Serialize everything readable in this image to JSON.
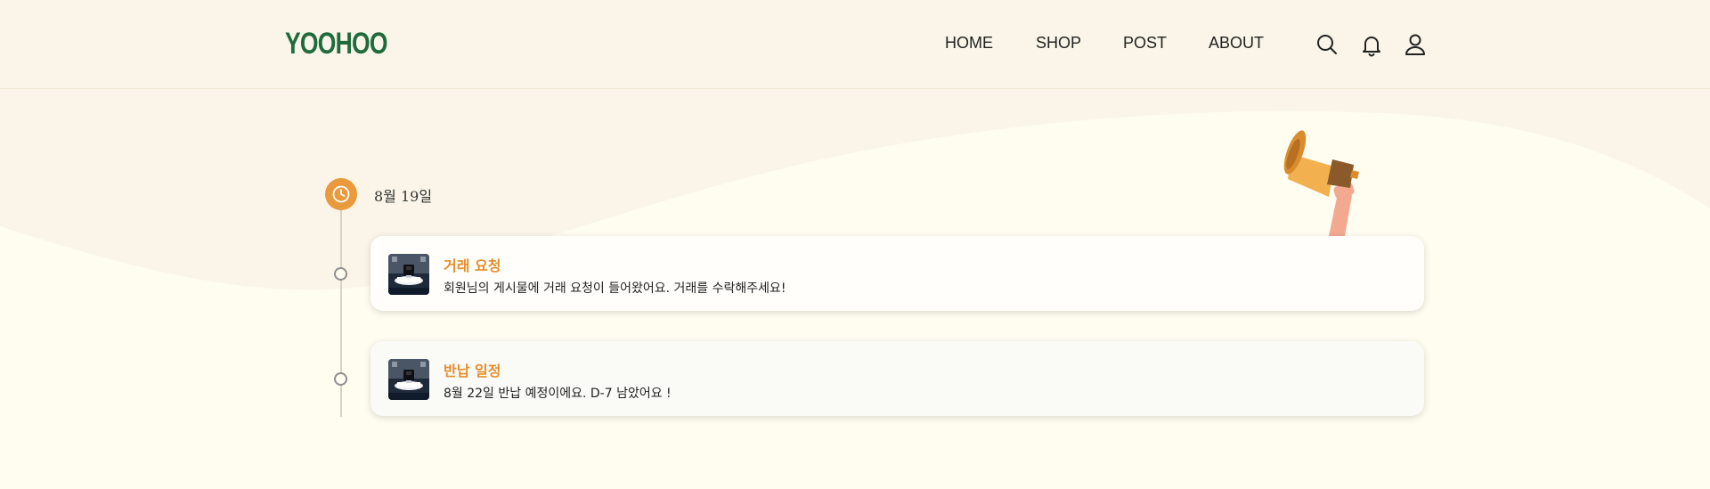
{
  "header": {
    "logo": "YOOHOO",
    "nav": [
      "HOME",
      "SHOP",
      "POST",
      "ABOUT"
    ],
    "icons": [
      "search-icon",
      "bell-icon",
      "user-icon"
    ]
  },
  "colors": {
    "brand_green": "#1f6b3c",
    "accent_orange": "#e58e2b",
    "badge_orange": "#e89a3c",
    "header_bg": "#faf5e8",
    "page_bg": "#fffcf0"
  },
  "timeline": {
    "date": "8월 19일",
    "notifications": [
      {
        "title": "거래 요청",
        "message": "회원님의 게시물에 거래 요청이 들어왔어요. 거래를 수락해주세요!",
        "thumbnail": "product-thumbnail"
      },
      {
        "title": "반납 일정",
        "message": "8월 22일 반납 예정이에요. D-7 남았어요 !",
        "thumbnail": "product-thumbnail"
      }
    ]
  }
}
